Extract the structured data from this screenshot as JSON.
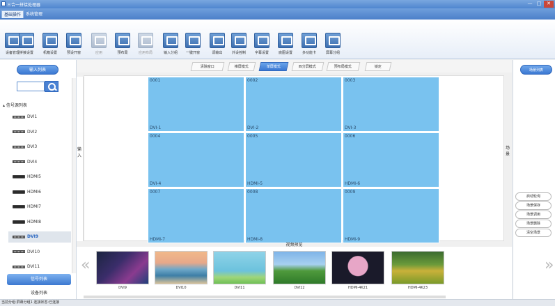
{
  "window": {
    "title": "三合一拼接处理器",
    "controls": [
      "—",
      "□",
      "✕"
    ]
  },
  "menu": {
    "tabs": [
      {
        "label": "基础操作",
        "active": true
      },
      {
        "label": "系统管理",
        "active": false
      }
    ]
  },
  "toolbar": {
    "items": [
      {
        "label": "设备管理",
        "icon": "device-icon",
        "enabled": true
      },
      {
        "label": "拼接设置",
        "icon": "splice-icon",
        "enabled": true
      },
      {
        "label": "机箱设置",
        "icon": "chassis-icon",
        "enabled": true
      },
      {
        "label": "预设开窗",
        "icon": "preset-icon",
        "enabled": true
      },
      {
        "label": "应用",
        "icon": "apply-icon",
        "enabled": false
      },
      {
        "label": "预布局",
        "icon": "prelayout-icon",
        "enabled": true
      },
      {
        "label": "应用布局",
        "icon": "apply-layout-icon",
        "enabled": false
      },
      {
        "label": "输入分组",
        "icon": "input-group-icon",
        "enabled": true
      },
      {
        "label": "一键开窗",
        "icon": "one-click-icon",
        "enabled": true
      },
      {
        "label": "调输出",
        "icon": "output-icon",
        "enabled": true
      },
      {
        "label": "外设控制",
        "icon": "peripheral-icon",
        "enabled": true
      },
      {
        "label": "字幕设置",
        "icon": "subtitle-icon",
        "enabled": true
      },
      {
        "label": "底图设置",
        "icon": "background-icon",
        "enabled": true
      },
      {
        "label": "多功能卡",
        "icon": "multicard-icon",
        "enabled": true
      },
      {
        "label": "屏幕分组",
        "icon": "screen-group-icon",
        "enabled": true
      }
    ]
  },
  "left": {
    "input_list_button": "输入列表",
    "search_placeholder": "",
    "tree_header": "信号源列表",
    "sources": [
      {
        "label": "DVI1",
        "kind": "dvi",
        "selected": false
      },
      {
        "label": "DVI2",
        "kind": "dvi",
        "selected": false
      },
      {
        "label": "DVI3",
        "kind": "dvi",
        "selected": false
      },
      {
        "label": "DVI4",
        "kind": "dvi",
        "selected": false
      },
      {
        "label": "HDMI5",
        "kind": "hdmi",
        "selected": false
      },
      {
        "label": "HDMI6",
        "kind": "hdmi",
        "selected": false
      },
      {
        "label": "HDMI7",
        "kind": "hdmi",
        "selected": false
      },
      {
        "label": "HDMI8",
        "kind": "hdmi",
        "selected": false
      },
      {
        "label": "DVI9",
        "kind": "dvi",
        "selected": true
      },
      {
        "label": "DVI10",
        "kind": "dvi",
        "selected": false
      },
      {
        "label": "DVI11",
        "kind": "dvi",
        "selected": false
      }
    ],
    "signal_list_tab": "信号列表",
    "device_list_tab": "设备列表"
  },
  "mode_tabs": [
    {
      "label": "清除窗口",
      "active": false
    },
    {
      "label": "推屏模式",
      "active": false
    },
    {
      "label": "单屏模式",
      "active": true
    },
    {
      "label": "四分屏模式",
      "active": false
    },
    {
      "label": "预布局模式",
      "active": false
    },
    {
      "label": "锁定",
      "active": false
    }
  ],
  "side_input_label": "输入",
  "side_scene_label": "场景",
  "wall": {
    "cells": [
      {
        "id": "0001",
        "source": "DVI-1"
      },
      {
        "id": "0002",
        "source": "DVI-2"
      },
      {
        "id": "0003",
        "source": "DVI-3"
      },
      {
        "id": "0004",
        "source": "DVI-4"
      },
      {
        "id": "0005",
        "source": "HDMI-5"
      },
      {
        "id": "0006",
        "source": "HDMI-6"
      },
      {
        "id": "0007",
        "source": "HDMI-7"
      },
      {
        "id": "0008",
        "source": "HDMI-8"
      },
      {
        "id": "0009",
        "source": "HDMI-9"
      }
    ],
    "cell_color": "#79c2ef"
  },
  "right": {
    "scene_list_button": "场景列表",
    "actions": [
      "启动轮询",
      "场景保存",
      "场景调用",
      "场景删除",
      "清空场景"
    ]
  },
  "preview": {
    "label": "视频预览",
    "thumbs": [
      {
        "label": "DVI9",
        "kind": "desktop"
      },
      {
        "label": "DVI10",
        "kind": "beach"
      },
      {
        "label": "DVI11",
        "kind": "cartoon"
      },
      {
        "label": "DVI12",
        "kind": "field"
      },
      {
        "label": "HDMI-4K21",
        "kind": "space"
      },
      {
        "label": "HDMI-4K23",
        "kind": "meadow"
      }
    ]
  },
  "status": {
    "text": "当前分组:屏幕分组1  连接状态:已连接"
  },
  "colors": {
    "accent": "#3b78d2",
    "wall_cell": "#79c2ef"
  }
}
